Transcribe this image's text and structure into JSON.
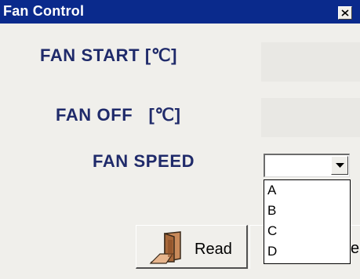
{
  "window": {
    "title": "Fan Control",
    "close_icon": "close-x-icon"
  },
  "form": {
    "fan_start_label": "FAN START [℃]",
    "fan_off_label": "FAN OFF   [℃]",
    "fan_speed_label": "FAN SPEED",
    "fan_start_value": "",
    "fan_off_value": "",
    "fan_speed_selected": ""
  },
  "dropdown": {
    "options": [
      "A",
      "B",
      "C",
      "D"
    ]
  },
  "buttons": {
    "read_label": "Read",
    "read_icon": "read-door-icon",
    "second_label_fragment": "e"
  },
  "colors": {
    "titlebar": "#0a2a8c",
    "label_text": "#1f2a6a",
    "window_bg": "#f0efeb"
  }
}
